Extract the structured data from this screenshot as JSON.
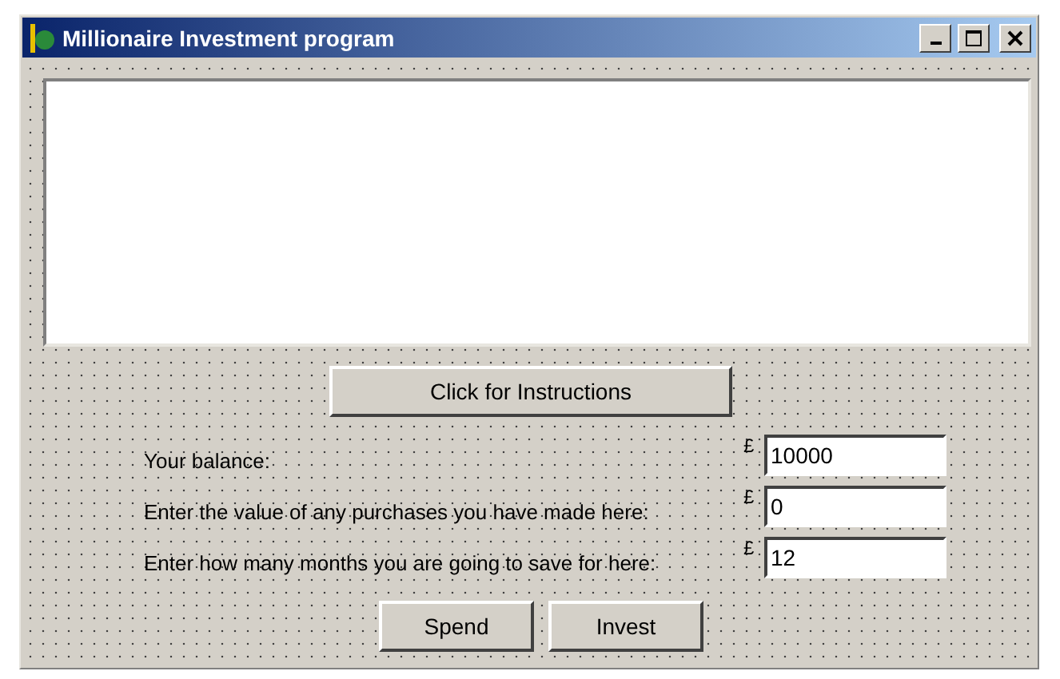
{
  "window": {
    "title": "Millionaire Investment program"
  },
  "instructions_button": "Click for Instructions",
  "rows": [
    {
      "label": "Your balance:",
      "currency": "£",
      "value": "10000"
    },
    {
      "label": "Enter the value of any purchases you have made here:",
      "currency": "£",
      "value": "0"
    },
    {
      "label": "Enter how many months you are going to save for here:",
      "currency": "£",
      "value": "12"
    }
  ],
  "buttons": [
    "Spend",
    "Invest"
  ]
}
